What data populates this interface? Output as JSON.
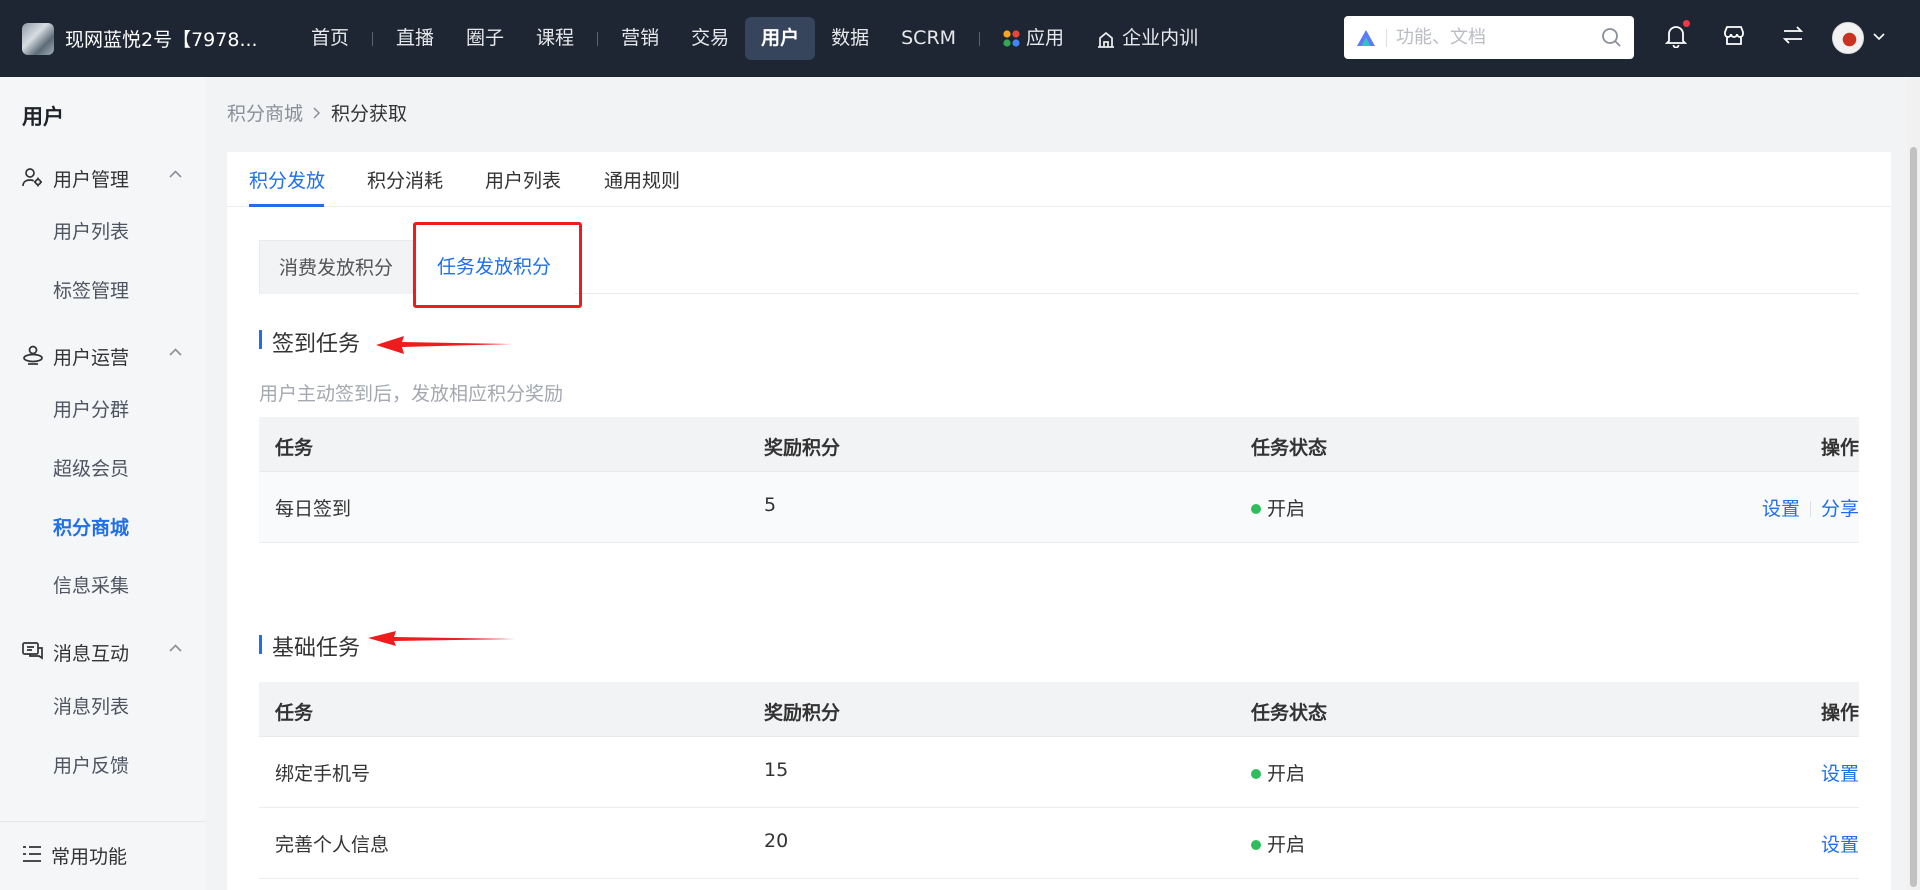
{
  "brand": {
    "name": "现网蓝悦2号【7978..."
  },
  "nav": {
    "items": [
      {
        "label": "首页"
      },
      {
        "label": "直播"
      },
      {
        "label": "圈子"
      },
      {
        "label": "课程"
      },
      {
        "label": "营销"
      },
      {
        "label": "交易"
      },
      {
        "label": "用户"
      },
      {
        "label": "数据"
      },
      {
        "label": "SCRM"
      },
      {
        "label": "应用"
      },
      {
        "label": "企业内训"
      }
    ],
    "active": "用户"
  },
  "search": {
    "placeholder": "功能、文档"
  },
  "sidebar": {
    "title": "用户",
    "groups": [
      {
        "label": "用户管理",
        "items": [
          "用户列表",
          "标签管理"
        ]
      },
      {
        "label": "用户运营",
        "items": [
          "用户分群",
          "超级会员",
          "积分商城",
          "信息采集"
        ]
      },
      {
        "label": "消息互动",
        "items": [
          "消息列表",
          "用户反馈"
        ]
      },
      {
        "label": "常用功能",
        "items": []
      }
    ],
    "active_item": "积分商城"
  },
  "breadcrumb": {
    "parent": "积分商城",
    "current": "积分获取"
  },
  "tabs": {
    "items": [
      "积分发放",
      "积分消耗",
      "用户列表",
      "通用规则"
    ],
    "active": "积分发放"
  },
  "subtabs": {
    "items": [
      "消费发放积分",
      "任务发放积分"
    ],
    "active": "任务发放积分"
  },
  "signin_section": {
    "title": "签到任务",
    "description": "用户主动签到后，发放相应积分奖励",
    "headers": [
      "任务",
      "奖励积分",
      "任务状态",
      "操作"
    ],
    "rows": [
      {
        "task": "每日签到",
        "points": "5",
        "status": "开启",
        "actions": [
          "设置",
          "分享"
        ]
      }
    ]
  },
  "basic_section": {
    "title": "基础任务",
    "headers": [
      "任务",
      "奖励积分",
      "任务状态",
      "操作"
    ],
    "rows": [
      {
        "task": "绑定手机号",
        "points": "15",
        "status": "开启",
        "actions": [
          "设置"
        ]
      },
      {
        "task": "完善个人信息",
        "points": "20",
        "status": "开启",
        "actions": [
          "设置"
        ]
      }
    ]
  },
  "colors": {
    "topbar": "#1f2633",
    "accent": "#1f6feb",
    "status_on": "#2fbd5d",
    "annotation": "#ee1c1c"
  }
}
